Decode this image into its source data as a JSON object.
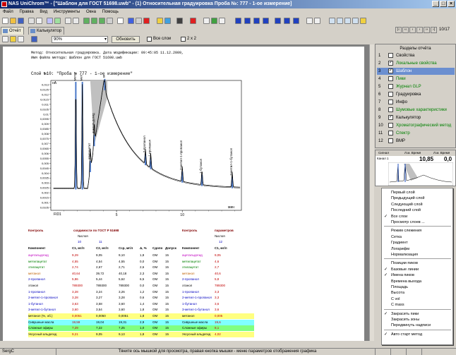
{
  "window": {
    "title": "NAS UniChrom™ - [\"Шаблон для ГОСТ 51698.uwb\" - (1) Относительная градуировка Проба №: 777 - 1-ое измерение]"
  },
  "menu": [
    "Файл",
    "Правка",
    "Вид",
    "Инструменты",
    "Окна",
    "Помощь"
  ],
  "tabs": [
    {
      "label": "Отчёт"
    },
    {
      "label": "Калькулятор"
    }
  ],
  "pager": {
    "count": "10/17"
  },
  "toolbar2": {
    "zoom": "90%",
    "refresh": "Обновить",
    "all_layers": "Все слои",
    "two_by_two": "2 x 2"
  },
  "report": {
    "header_line1": "Метод: Относительная градуировка. Дата модификации: 09:45:05 11.12.2009,",
    "header_line2": "Имя файла метода: Шаблон для ГОСТ 51698.uwb",
    "layer_title": "Слой №10: \"Проба № 777 - 1-ое измерение\""
  },
  "chart_data": {
    "type": "line",
    "ylabel": "нА",
    "xlabel": "мин",
    "trace_label": "FID1",
    "yticks": [
      "0,013",
      "0,0125",
      "0,012",
      "0,0115",
      "0,011",
      "0,0105",
      "0,01",
      "0,0095",
      "0,009",
      "0,0085",
      "0,008",
      "0,0075",
      "0,007",
      "0,0065",
      "0,006",
      "0,0055",
      "0,005",
      "0,0045",
      "0,004",
      "0,0035",
      "0,003",
      "0,0025",
      "0,002",
      "0,0015",
      "0,001",
      "0,0105"
    ],
    "ylim": [
      0.0095,
      0.013
    ],
    "xticks": [
      "5",
      "10"
    ],
    "xlim": [
      0,
      14.5
    ],
    "peaks": [
      {
        "name": "метанол",
        "rt": 1.9
      },
      {
        "name": "метилацетат",
        "rt": 2.4
      },
      {
        "name": "этилацетат",
        "rt": 3.0
      },
      {
        "name": "ацетальдегид",
        "rt": 3.3
      },
      {
        "name": "метанол",
        "rt": 4.1
      },
      {
        "name": "2-пропанол",
        "rt": 7.2
      },
      {
        "name": "1-пропанол",
        "rt": 7.6
      },
      {
        "name": "2-метил-1-пропанол",
        "rt": 10.0
      },
      {
        "name": "1-бутанол",
        "rt": 11.5
      },
      {
        "name": "3-метил-1-бутанол",
        "rt": 13.8
      }
    ]
  },
  "table": {
    "ctrl_left": "Контроль",
    "ctrl_mid": "сходимости по ГОСТ Р 51698",
    "ctrl_right": "Контроль",
    "param_label": "параметров",
    "nsloya_left": "№слоя",
    "nsloya_right": "№слоя",
    "nums": [
      "10",
      "11",
      "12"
    ],
    "headers": [
      "Компонент",
      "C1, мг/л",
      "C2, мг/л",
      "Сср, мг/л",
      "Δ, %",
      "Сдопо",
      "Допуск",
      "Компонент",
      "C1, мг/л"
    ],
    "rows": [
      [
        "ацетальдегид",
        "9,29",
        "9,05",
        "9,10",
        "1,8",
        "ОМ",
        "15",
        "ацетальдегид",
        "9,05"
      ],
      [
        "метилацетат",
        "4,55",
        "4,54",
        "4,55",
        "0,0",
        "ОМ",
        "15",
        "метилацетат",
        "4,6"
      ],
      [
        "этилацетат",
        "2,74",
        "2,67",
        "2,71",
        "2,6",
        "ОМ",
        "15",
        "этилацетат",
        "2,7"
      ],
      [
        "метанол",
        "40,64",
        "39,72",
        "40,18",
        "2,3",
        "ОМ",
        "15",
        "метанол",
        "40,6"
      ],
      [
        "2-пропанол",
        "5,86",
        "5,44",
        "5,62",
        "6,5",
        "ОМ",
        "15",
        "2-пропанол",
        "5,8"
      ],
      [
        "этанол",
        "789300",
        "789300",
        "789300",
        "0,0",
        "ОМ",
        "15",
        "этанол",
        "789300"
      ],
      [
        "1-пропанол",
        "3,28",
        "3,24",
        "3,26",
        "1,2",
        "ОМ",
        "15",
        "1-пропанол",
        "3,3"
      ],
      [
        "2-метил-1-пропанол",
        "3,28",
        "3,27",
        "3,28",
        "0,6",
        "ОМ",
        "15",
        "2-метил-1-пропанол",
        "3,3"
      ],
      [
        "1-бутанол",
        "3,63",
        "3,58",
        "3,60",
        "1,4",
        "ОМ",
        "15",
        "1-бутанол",
        "3,6"
      ],
      [
        "3-метил-1-бутанол",
        "3,60",
        "3,54",
        "3,60",
        "1,8",
        "ОМ",
        "15",
        "3-метил-1-бутанол",
        "3,6"
      ],
      [
        "метанол (%, об.)",
        "0,0051",
        "0,0050",
        "0,0051",
        "1,8",
        "ОМ",
        "15",
        "метанол",
        "0,005"
      ],
      [
        "Сивушные масла",
        "19,59",
        "19,04",
        "19,31",
        "2,9",
        "ОМ",
        "15",
        "Сивушные масла",
        "19,6"
      ],
      [
        "Сложные эфиры",
        "7,29",
        "7,22",
        "7,25",
        "1,0",
        "ОМ",
        "15",
        "Сложные эфиры",
        "8,1"
      ],
      [
        "Уксусный альдегид",
        "9,21",
        "9,05",
        "9,13",
        "1,8",
        "ОМ",
        "15",
        "Уксусный альдегид",
        "4,02"
      ]
    ]
  },
  "sections": {
    "header": "Разделы отчёта",
    "items": [
      {
        "n": "1",
        "label": "Свойства",
        "checked": false,
        "color": "#000000"
      },
      {
        "n": "2",
        "label": "Локальные свойства",
        "checked": true,
        "color": "#008000"
      },
      {
        "n": "3",
        "label": "Шаблон",
        "checked": true,
        "color": "#ffffff"
      },
      {
        "n": "4",
        "label": "Пики",
        "checked": false,
        "color": "#008000"
      },
      {
        "n": "5",
        "label": "Журнал GLP",
        "checked": false,
        "color": "#008000"
      },
      {
        "n": "6",
        "label": "Градуировка",
        "checked": false,
        "color": "#000000"
      },
      {
        "n": "7",
        "label": "Инфо",
        "checked": false,
        "color": "#000000"
      },
      {
        "n": "8",
        "label": "Шумовые характеристики",
        "checked": false,
        "color": "#008000"
      },
      {
        "n": "9",
        "label": "Калькулятор",
        "checked": true,
        "color": "#000000"
      },
      {
        "n": "10",
        "label": "Хроматографический метод",
        "checked": false,
        "color": "#008000"
      },
      {
        "n": "11",
        "label": "Спектр",
        "checked": false,
        "color": "#008000"
      },
      {
        "n": "12",
        "label": "ВМР",
        "checked": false,
        "color": "#000000"
      }
    ]
  },
  "mini": {
    "col1": "Сигнал",
    "col2": "Л.м. Время",
    "col3": "Л.м. Время",
    "chan": "Канал 1",
    "v1": "10,85",
    "v2": "0,0"
  },
  "context_menu": {
    "groups": [
      [
        {
          "label": "Первый слой",
          "checked": false
        },
        {
          "label": "Предыдущий слой",
          "checked": false
        },
        {
          "label": "Следующий слой",
          "checked": false
        },
        {
          "label": "Последний слой",
          "checked": false
        },
        {
          "label": "Все слои",
          "checked": true
        },
        {
          "label": "Просмотр слоев ...",
          "checked": false
        }
      ],
      [
        {
          "label": "Режим слежения",
          "checked": false
        },
        {
          "label": "Сетка",
          "checked": false
        },
        {
          "label": "Градиент",
          "checked": false
        },
        {
          "label": "Логарифм",
          "checked": false
        },
        {
          "label": "Нормализация",
          "checked": false
        }
      ],
      [
        {
          "label": "Позиции пиков",
          "checked": false
        },
        {
          "label": "Базовые линии",
          "checked": true
        },
        {
          "label": "Имена пиков",
          "checked": true
        },
        {
          "label": "Времена выхода",
          "checked": false
        },
        {
          "label": "Площадь",
          "checked": false
        },
        {
          "label": "Высота",
          "checked": false
        },
        {
          "label": "C vol",
          "checked": false
        },
        {
          "label": "C mass",
          "checked": false
        }
      ],
      [
        {
          "label": "Закрасить пики",
          "checked": true
        },
        {
          "label": "Закрасить зоны",
          "checked": false
        },
        {
          "label": "Передвинуть надписи",
          "checked": false
        }
      ],
      [
        {
          "label": "Авто старт метод",
          "checked": true
        }
      ]
    ]
  },
  "status": {
    "user": "SergC",
    "hint": "Тяните ось мышкой для просмотра, правая кнопка мышки - меню параметров отображения графика"
  },
  "colors": {
    "title_start": "#0a246a",
    "title_end": "#a6caf0",
    "selected": "#6b8fd0",
    "peak_fill": "#4a78c8",
    "gray_fill": "#c0c0c0"
  }
}
